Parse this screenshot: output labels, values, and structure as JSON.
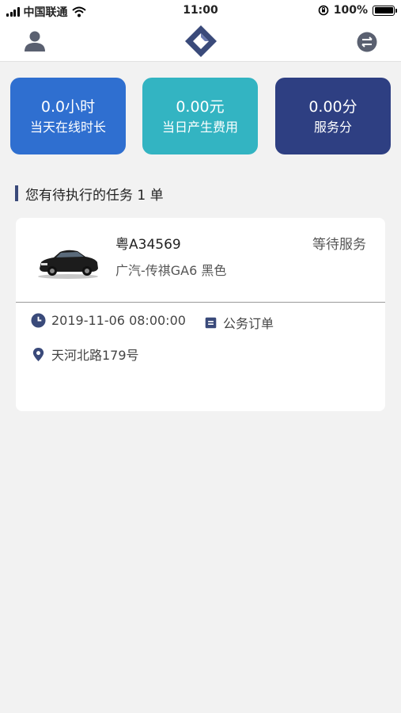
{
  "status_bar": {
    "carrier": "中国联通",
    "time": "11:00",
    "battery": "100%"
  },
  "nav": {
    "user_icon": "user-icon",
    "logo_icon": "diamond-logo",
    "switch_icon": "swap-icon"
  },
  "stats": [
    {
      "value": "0.0小时",
      "label": "当天在线时长",
      "color": "#2f6fd0"
    },
    {
      "value": "0.00元",
      "label": "当日产生费用",
      "color": "#33b4c2"
    },
    {
      "value": "0.00分",
      "label": "服务分",
      "color": "#2e3f82"
    }
  ],
  "section_title": "您有待执行的任务 1 单",
  "task": {
    "plate": "粤A34569",
    "status": "等待服务",
    "car_model": "广汽-传祺GA6 黑色",
    "time": "2019-11-06 08:00:00",
    "order_type": "公务订单",
    "address": "天河北路179号"
  },
  "colors": {
    "accent_dark": "#3a4a7a",
    "background": "#f2f2f2"
  }
}
